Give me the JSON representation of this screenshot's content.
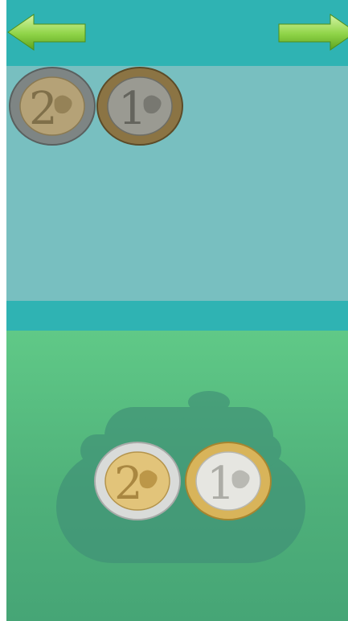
{
  "navigation": {
    "previous_icon": "arrow-left-icon",
    "next_icon": "arrow-right-icon",
    "arrow_color": "#7ec83a"
  },
  "tray": {
    "coins": [
      {
        "value": "2",
        "state": "dimmed"
      },
      {
        "value": "1",
        "state": "dimmed"
      }
    ]
  },
  "wallet": {
    "icon": "purse-icon",
    "coins": [
      {
        "value": "2",
        "state": "active"
      },
      {
        "value": "1",
        "state": "active"
      }
    ]
  },
  "colors": {
    "header": "#2fb3b3",
    "tray": "#78bfc0",
    "wallet_top": "#60c987",
    "wallet_bottom": "#46a576",
    "gold": "#d8b45a",
    "silver": "#d9dbd9"
  }
}
